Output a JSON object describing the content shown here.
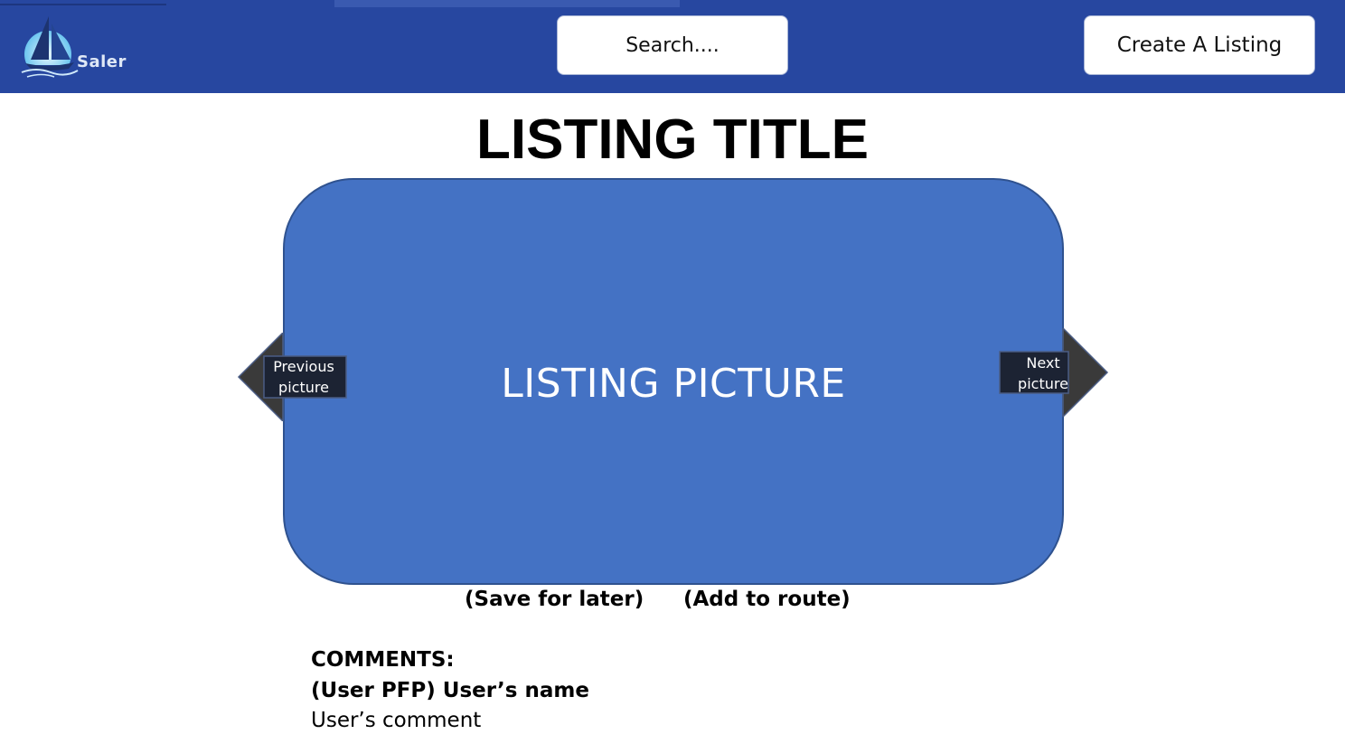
{
  "header": {
    "logo_text": "Saler",
    "search_label": "Search....",
    "create_listing_label": "Create A Listing"
  },
  "listing": {
    "title": "LISTING TITLE",
    "picture_label": "LISTING PICTURE",
    "previous_label_line1": "Previous",
    "previous_label_line2": "picture",
    "next_label_line1": "Next",
    "next_label_line2": "picture"
  },
  "actions": {
    "save_label": "(Save for later)",
    "route_label": "(Add to route)"
  },
  "comments": {
    "heading": "COMMENTS:",
    "items": [
      {
        "user": "(User PFP) User’s name",
        "text": "User’s comment"
      }
    ]
  },
  "colors": {
    "header_bg": "#2747a0",
    "picture_fill": "#4472c4",
    "picture_border": "#2f528f",
    "arrow_dark": "#3a3a3a",
    "arrow_label_bg": "#1c2333"
  },
  "icons": {
    "logo": "sailboat-logo-icon",
    "previous": "arrow-left-icon",
    "next": "arrow-right-icon"
  }
}
